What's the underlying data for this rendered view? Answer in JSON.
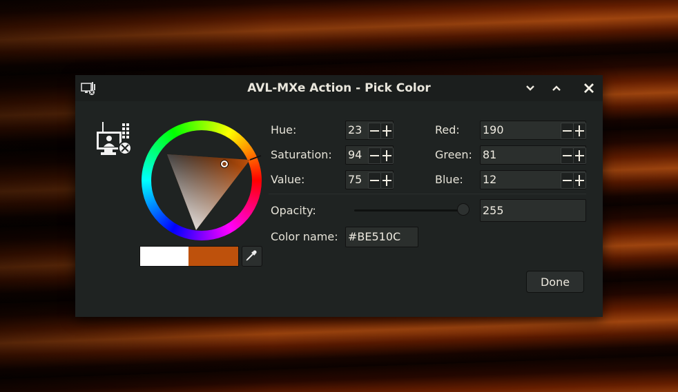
{
  "window": {
    "title": "AVL-MXe Action - Pick Color",
    "minimize_icon": "chevron-down-icon",
    "maximize_icon": "chevron-up-icon",
    "close_icon": "close-icon"
  },
  "hsv": {
    "hue_label": "Hue:",
    "hue": "23",
    "saturation_label": "Saturation:",
    "saturation": "94",
    "value_label": "Value:",
    "value": "75"
  },
  "rgb": {
    "red_label": "Red:",
    "red": "190",
    "green_label": "Green:",
    "green": "81",
    "blue_label": "Blue:",
    "blue": "12"
  },
  "opacity": {
    "label": "Opacity:",
    "value": "255",
    "fraction": 1.0
  },
  "color_name": {
    "label": "Color name:",
    "value": "#BE510C"
  },
  "swatches": {
    "previous": "#FFFFFF",
    "current": "#BE510C"
  },
  "done_label": "Done"
}
